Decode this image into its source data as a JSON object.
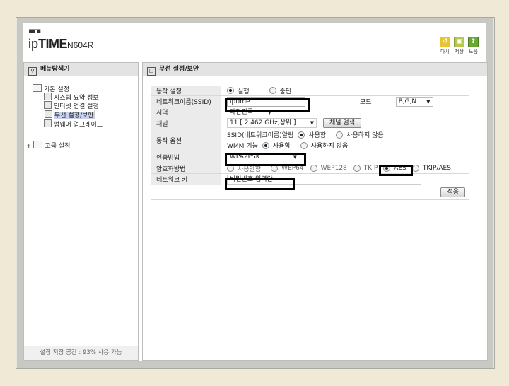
{
  "header": {
    "logo_dots": "■■□■",
    "logo_prefix": "ip",
    "logo_brand": "TIME",
    "logo_model": "N604R",
    "buttons": [
      {
        "label": "다시",
        "icon": "back-icon",
        "glyph": "↺"
      },
      {
        "label": "저장",
        "icon": "save-icon",
        "glyph": "▣"
      },
      {
        "label": "도움",
        "icon": "help-icon",
        "glyph": "?"
      }
    ]
  },
  "sidebar": {
    "title": "메뉴탐색기",
    "groups": [
      {
        "label": "기본 설정",
        "items": [
          "시스템 요약 정보",
          "인터넷 연결 설정",
          "무선 설정/보안",
          "펌웨어 업그레이드"
        ],
        "selected": 2
      },
      {
        "label": "고급 설정"
      }
    ],
    "storage": "설정 저장 공간 : 93% 사용 가능"
  },
  "main": {
    "title": "무선 설정/보안",
    "rows": {
      "operation": {
        "label": "동작 설정",
        "run": "실행",
        "stop": "중단",
        "selected": "run"
      },
      "ssid": {
        "label": "네트워크이름(SSID)",
        "value": "iptime",
        "mode_label": "모드",
        "mode_value": "B,G,N"
      },
      "region": {
        "label": "지역",
        "value": "대한민국"
      },
      "channel": {
        "label": "채널",
        "value": "11  [ 2.462 GHz,상위 ]",
        "search": "채널 검색"
      },
      "options": {
        "label": "동작 옵션",
        "ssid_alarm": "SSID(네트워크이름)알림",
        "wmm": "WMM 기능",
        "use": "사용함",
        "not_use": "사용하지 않음"
      },
      "auth": {
        "label": "인증방법",
        "value": "WPA2PSK"
      },
      "encryption": {
        "label": "암호화방법",
        "options": [
          "사용안함",
          "WEP64",
          "WEP128",
          "TKIP",
          "AES",
          "TKIP/AES"
        ],
        "selected": "AES"
      },
      "key": {
        "label": "네트워크 키",
        "value": "비밀번호 입력란"
      }
    },
    "apply": "적용"
  },
  "colors": {
    "highlight": "#000000",
    "label_bg": "#ebebeb",
    "panel_title_bg": "#e3e3e3",
    "frame": "#c9c9c4",
    "background": "#efe9d6"
  }
}
